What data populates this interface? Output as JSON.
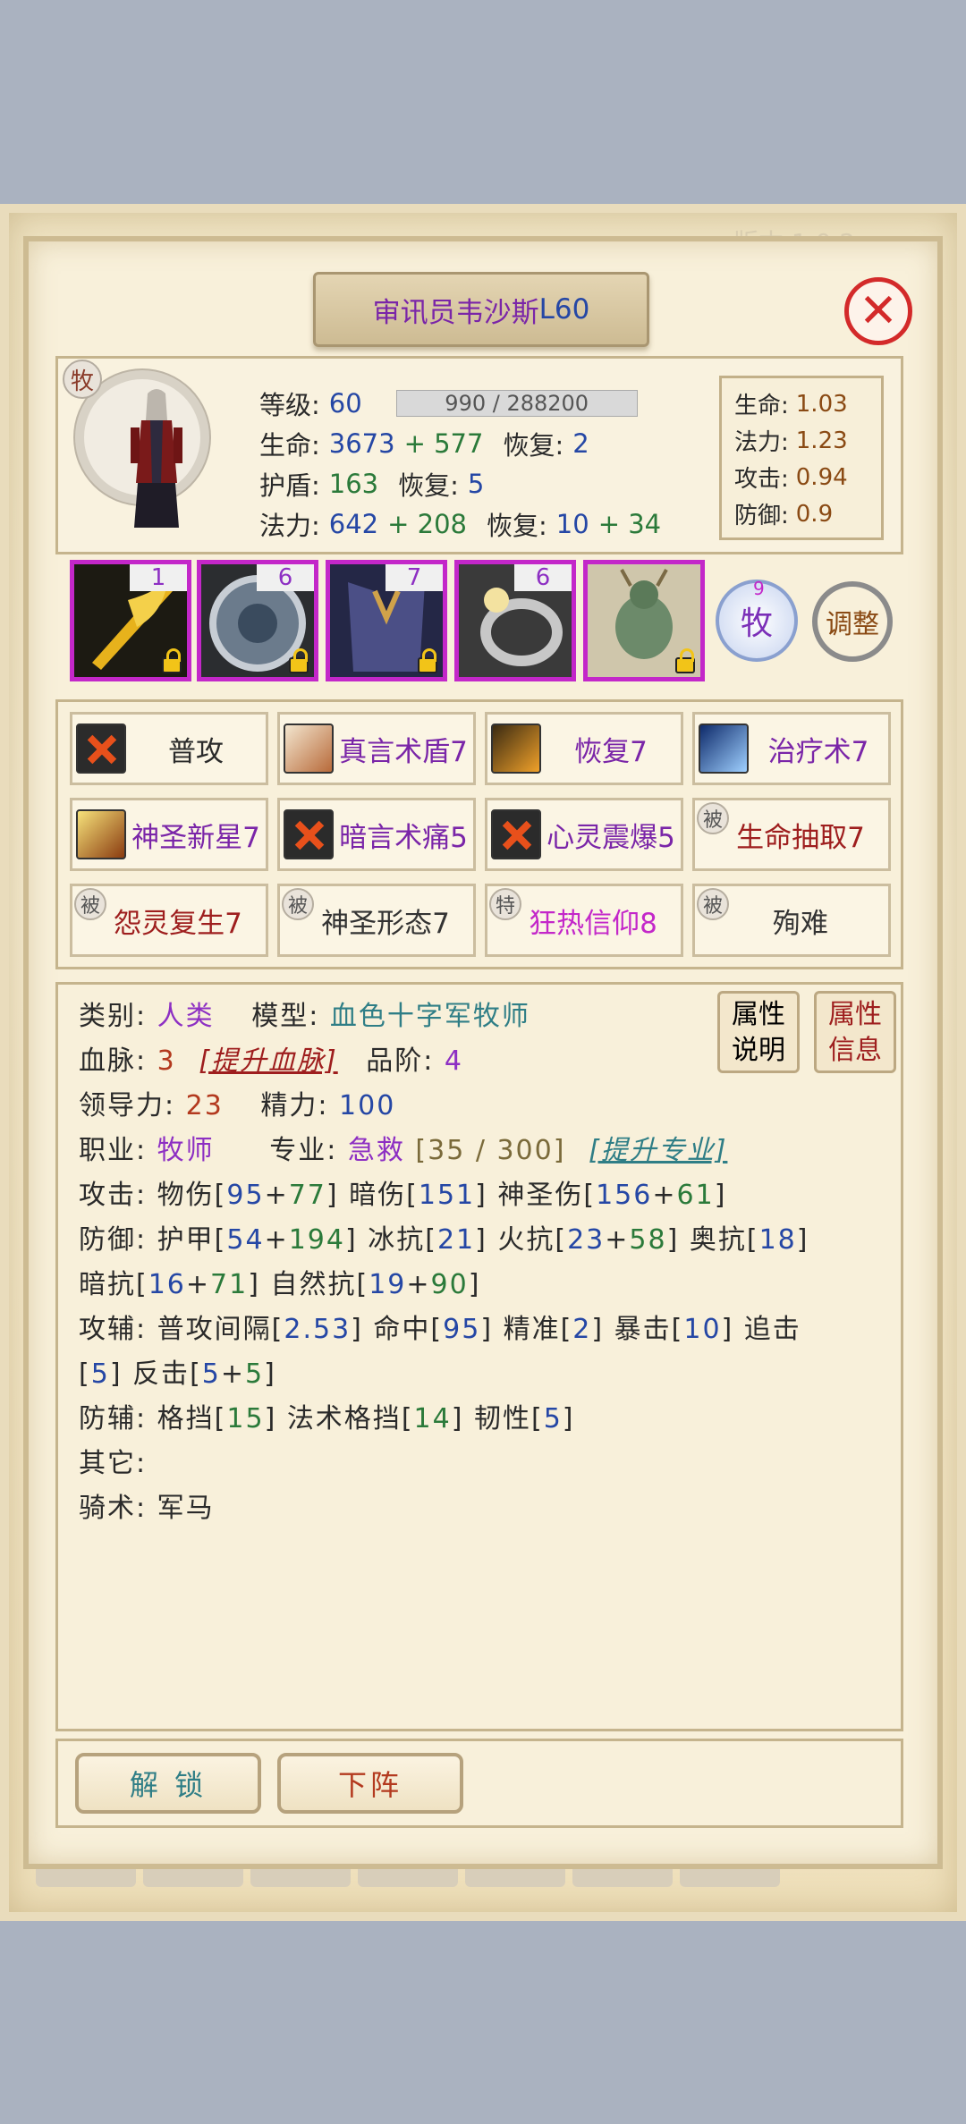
{
  "window": {
    "version": "版本 1.0.2",
    "title_name": "审讯员韦沙斯",
    "title_level": "L60",
    "close_icon": "close-icon"
  },
  "hero": {
    "class_badge": "牧",
    "level_label": "等级:",
    "level": "60",
    "exp": "990 / 288200",
    "hp_label": "生命:",
    "hp_base": "3673",
    "hp_plus": "+ 577",
    "hp_regen_label": "恢复:",
    "hp_regen": "2",
    "shield_label": "护盾:",
    "shield": "163",
    "shield_regen_label": "恢复:",
    "shield_regen": "5",
    "mp_label": "法力:",
    "mp_base": "642",
    "mp_plus": "+ 208",
    "mp_regen_label": "恢复:",
    "mp_regen_base": "10",
    "mp_regen_plus": "+ 34"
  },
  "ratios": [
    {
      "label": "生命:",
      "value": "1.03"
    },
    {
      "label": "法力:",
      "value": "1.23"
    },
    {
      "label": "攻击:",
      "value": "0.94"
    },
    {
      "label": "防御:",
      "value": "0.9"
    }
  ],
  "equipment": [
    {
      "name": "weapon-icon",
      "level": "1",
      "color": "#e7b21c"
    },
    {
      "name": "shield-icon",
      "level": "6",
      "color": "#6b7b8c"
    },
    {
      "name": "armor-icon",
      "level": "7",
      "color": "#4b4f86"
    },
    {
      "name": "ring-icon",
      "level": "6",
      "color": "#9a9a9a"
    },
    {
      "name": "mount-icon",
      "level": "",
      "color": "#6c8a6a"
    }
  ],
  "class_emblem": {
    "text": "牧",
    "number": "9"
  },
  "adjust_label": "调整",
  "skills": [
    {
      "name": "普攻",
      "color": "#2a2a2a",
      "tag": "",
      "icon": "x-icon"
    },
    {
      "name": "真言术盾7",
      "color": "#7a25a8",
      "tag": "",
      "icon": "shield-spell-icon"
    },
    {
      "name": "恢复7",
      "color": "#7a25a8",
      "tag": "",
      "icon": "renew-icon"
    },
    {
      "name": "治疗术7",
      "color": "#7a25a8",
      "tag": "",
      "icon": "heal-icon"
    },
    {
      "name": "神圣新星7",
      "color": "#7a25a8",
      "tag": "",
      "icon": "holy-nova-icon"
    },
    {
      "name": "暗言术痛5",
      "color": "#7a25a8",
      "tag": "",
      "icon": "x-icon"
    },
    {
      "name": "心灵震爆5",
      "color": "#7a25a8",
      "tag": "",
      "icon": "x-icon"
    },
    {
      "name": "生命抽取7",
      "color": "#9e1e1e",
      "tag": "被",
      "icon": ""
    },
    {
      "name": "怨灵复生7",
      "color": "#9e1e1e",
      "tag": "被",
      "icon": ""
    },
    {
      "name": "神圣形态7",
      "color": "#333333",
      "tag": "被",
      "icon": ""
    },
    {
      "name": "狂热信仰8",
      "color": "#c327c9",
      "tag": "特",
      "icon": ""
    },
    {
      "name": "殉难",
      "color": "#333333",
      "tag": "被",
      "icon": ""
    }
  ],
  "attr_buttons": [
    {
      "line1": "属性",
      "line2": "说明",
      "color": "#333333"
    },
    {
      "line1": "属性",
      "line2": "信息",
      "color": "#9e1e1e"
    }
  ],
  "attrs": {
    "category_label": "类别:",
    "category": "人类",
    "model_label": "模型:",
    "model": "血色十字军牧师",
    "bloodline_label": "血脉:",
    "bloodline": "3",
    "bloodline_link": "[提升血脉]",
    "rank_label": "品阶:",
    "rank": "4",
    "leadership_label": "领导力:",
    "leadership": "23",
    "energy_label": "精力:",
    "energy": "100",
    "job_label": "职业:",
    "job": "牧师",
    "profession_label": "专业:",
    "profession": "急救",
    "profession_progress": "[35 / 300]",
    "profession_link": "[提升专业]",
    "attack_label": "攻击:",
    "phys_label": "物伤",
    "phys_base": "95",
    "phys_plus": "77",
    "shadow_label": "暗伤",
    "shadow": "151",
    "holy_label": "神圣伤",
    "holy_base": "156",
    "holy_plus": "61",
    "defense_label": "防御:",
    "armor_label": "护甲",
    "armor_base": "54",
    "armor_plus": "194",
    "frost_label": "冰抗",
    "frost": "21",
    "fire_label": "火抗",
    "fire_base": "23",
    "fire_plus": "58",
    "arcane_label": "奥抗",
    "arcane": "18",
    "shadow_res_label": "暗抗",
    "shadow_res_base": "16",
    "shadow_res_plus": "71",
    "nature_label": "自然抗",
    "nature_base": "19",
    "nature_plus": "90",
    "atk_aux_label": "攻辅:",
    "interval_label": "普攻间隔",
    "interval": "2.53",
    "hit_label": "命中",
    "hit": "95",
    "precision_label": "精准",
    "precision": "2",
    "crit_label": "暴击",
    "crit": "10",
    "chase_label": "追击",
    "chase": "5",
    "counter_label": "反击",
    "counter_base": "5",
    "counter_plus": "5",
    "def_aux_label": "防辅:",
    "block_label": "格挡",
    "block": "15",
    "spell_block_label": "法术格挡",
    "spell_block": "14",
    "toughness_label": "韧性",
    "toughness": "5",
    "other_label": "其它:",
    "riding_label": "骑术:",
    "riding": "军马"
  },
  "buttons": {
    "unlock": "解 锁",
    "unlock_color": "#2f7e86",
    "retreat": "下阵",
    "retreat_color": "#b3391e"
  }
}
